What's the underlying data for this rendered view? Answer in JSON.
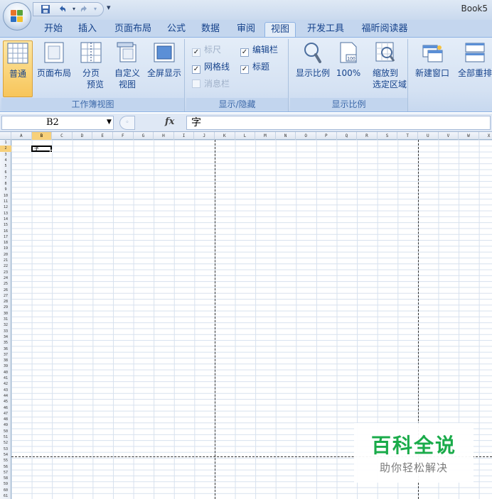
{
  "window": {
    "title": "Book5"
  },
  "quick_access": {
    "save_icon": "save-icon",
    "undo_icon": "undo-icon",
    "redo_icon": "redo-icon",
    "customize_glyph": "▾"
  },
  "tabs": [
    {
      "label": "开始"
    },
    {
      "label": "插入"
    },
    {
      "label": "页面布局"
    },
    {
      "label": "公式"
    },
    {
      "label": "数据"
    },
    {
      "label": "审阅"
    },
    {
      "label": "视图",
      "active": true
    },
    {
      "label": "开发工具"
    },
    {
      "label": "福昕阅读器"
    }
  ],
  "ribbon": {
    "workbook_views": {
      "label": "工作簿视图",
      "normal": "普通",
      "page_layout": "页面布局",
      "page_break_1": "分页",
      "page_break_2": "预览",
      "custom_1": "自定义",
      "custom_2": "视图",
      "fullscreen": "全屏显示"
    },
    "show_hide": {
      "label": "显示/隐藏",
      "ruler": {
        "label": "标尺",
        "checked": true,
        "enabled": false
      },
      "formula_bar": {
        "label": "编辑栏",
        "checked": true,
        "enabled": true
      },
      "gridlines": {
        "label": "网格线",
        "checked": true,
        "enabled": true
      },
      "headings": {
        "label": "标题",
        "checked": true,
        "enabled": true
      },
      "message_bar": {
        "label": "消息栏",
        "checked": false,
        "enabled": false
      }
    },
    "zoom": {
      "label": "显示比例",
      "zoom": "显示比例",
      "hundred": "100%",
      "sel_1": "缩放到",
      "sel_2": "选定区域",
      "hundred_icon_text": "100"
    },
    "window": {
      "new_window": "新建窗口",
      "arrange_all": "全部重排"
    }
  },
  "formula_bar": {
    "name_box": "B2",
    "fx": "fx",
    "content": "字"
  },
  "sheet": {
    "columns": [
      "A",
      "B",
      "C",
      "D",
      "E",
      "F",
      "G",
      "H",
      "I",
      "J",
      "K",
      "L",
      "M",
      "N",
      "O",
      "P",
      "Q",
      "R",
      "S",
      "T",
      "U",
      "V",
      "W",
      "X"
    ],
    "selected_column": "B",
    "rows": [
      "1",
      "2",
      "3",
      "4",
      "5",
      "6",
      "7",
      "8",
      "9",
      "10",
      "11",
      "12",
      "13",
      "14",
      "15",
      "16",
      "17",
      "18",
      "19",
      "20",
      "21",
      "22",
      "23",
      "24",
      "25",
      "26",
      "27",
      "28",
      "29",
      "30",
      "31",
      "32",
      "33",
      "34",
      "35",
      "36",
      "37",
      "38",
      "39",
      "40",
      "41",
      "42",
      "43",
      "44",
      "45",
      "46",
      "47",
      "48",
      "49",
      "50",
      "51",
      "52",
      "53",
      "54",
      "55",
      "56",
      "57",
      "58",
      "59",
      "60",
      "61"
    ],
    "selected_row": "2",
    "active_cell_value": "字"
  },
  "watermark": {
    "main": "百科全说",
    "sub": "助你轻松解决"
  },
  "colors": {
    "accent": "#15428b",
    "ribbon": "#dbe6f4",
    "selected_header": "#f7d07a",
    "watermark_green": "#1aab4a"
  }
}
